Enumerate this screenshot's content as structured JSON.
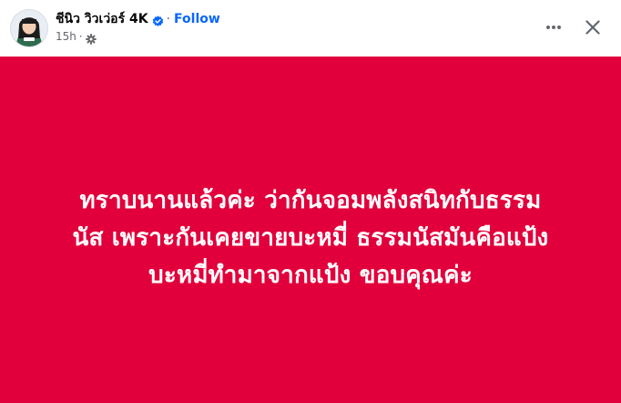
{
  "post": {
    "author": "ชีนิว วิวเว่อร์ 4K",
    "follow_label": "Follow",
    "separator": "·",
    "timestamp": "15h",
    "audience_icon": "gear-icon",
    "more_icon": "more-icon",
    "close_icon": "close-icon",
    "verified_icon": "verified-badge-icon",
    "background_color": "#e2003c",
    "text_color": "#ffffff",
    "lines": [
      "ทราบนานแล้วค่ะ ว่ากันจอมพลังสนิทกับธรรม",
      "นัส เพราะกันเคยขายบะหมี่ ธรรมนัสมันคือแป้ง",
      "บะหมี่ทำมาจากแป้ง ขอบคุณค่ะ"
    ]
  }
}
